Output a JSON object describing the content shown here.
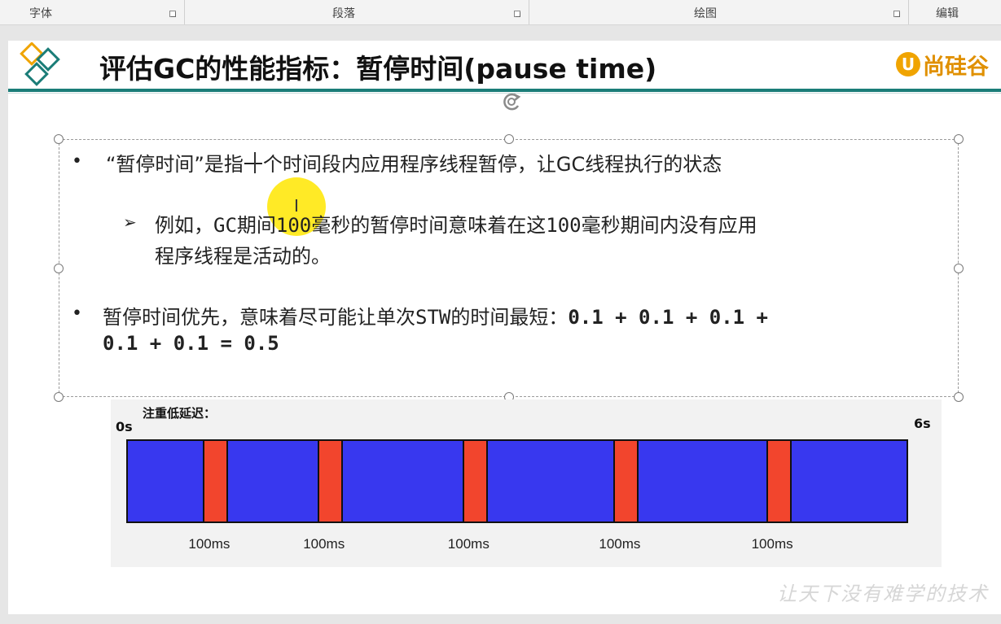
{
  "ribbon": {
    "groups": [
      {
        "label": "字体"
      },
      {
        "label": "段落"
      },
      {
        "label": "绘图"
      },
      {
        "label": "编辑"
      }
    ]
  },
  "slide": {
    "title": "评估GC的性能指标：暂停时间(pause time)",
    "brand_mark": "U",
    "brand_name": "尚硅谷",
    "bullets": {
      "b1": {
        "marker": "•",
        "text": "“暂停时间”是指一个时间段内应用程序线程暂停，让GC线程执行的状态"
      },
      "b1_sub": {
        "marker": "➢",
        "line1_a": "例如，",
        "line1_b": "GC",
        "line1_c": "期间",
        "line1_d": "100",
        "line1_e": "毫秒的暂停时间意味着在这",
        "line1_f": "100",
        "line1_g": "毫秒期间内没有应用",
        "line2": "程序线程是活动的。"
      },
      "b2": {
        "marker": "•",
        "line1_text": "暂停时间优先，意味着尽可能让单次",
        "line1_stw": "STW",
        "line1_rest": "的时间最短：",
        "line1_math": "0.1 + 0.1 + 0.1 +",
        "line2_math": "0.1 + 0.1 = 0.5"
      }
    },
    "watermark": "让天下没有难学的技术"
  },
  "chart_data": {
    "type": "timeline",
    "title": "注重低延迟：",
    "x_start_label": "0s",
    "x_end_label": "6s",
    "xlim": [
      0,
      6
    ],
    "colors": {
      "run": "#3838ef",
      "pause": "#f2452d"
    },
    "pauses": [
      {
        "start": 0.59,
        "label": "100ms"
      },
      {
        "start": 1.47,
        "label": "100ms"
      },
      {
        "start": 2.58,
        "label": "100ms"
      },
      {
        "start": 3.74,
        "label": "100ms"
      },
      {
        "start": 4.91,
        "label": "100ms"
      }
    ]
  }
}
